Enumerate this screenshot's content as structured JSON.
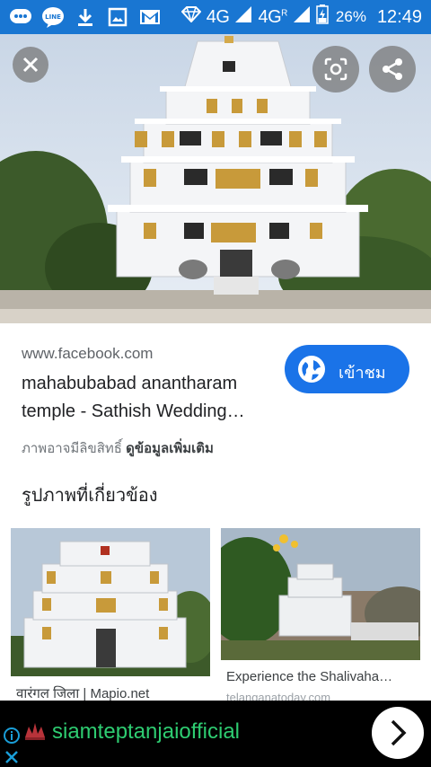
{
  "status_bar": {
    "network": "4G",
    "network2": "4G",
    "network2_sup": "R",
    "battery": "26%",
    "time": "12:49",
    "notification_icons": [
      "chat-bubble-icon",
      "line-app-icon",
      "download-icon",
      "image-icon",
      "gmail-icon"
    ]
  },
  "hero": {
    "buttons": [
      "close-icon",
      "lens-icon",
      "share-icon"
    ]
  },
  "result": {
    "domain": "www.facebook.com",
    "title": "mahabubabad anantharam temple - Sathish Wedding…",
    "visit_label": "เข้าชม",
    "copyright_text": "ภาพอาจมีลิขสิทธิ์",
    "more_info": "ดูข้อมูลเพิ่มเติม"
  },
  "related": {
    "heading": "รูปภาพที่เกี่ยวข้อง",
    "items": [
      {
        "caption": "वारंगल जिला | Mapio.net",
        "source": ""
      },
      {
        "caption": "Experience the Shalivaha…",
        "source": "telanganatoday.com"
      }
    ]
  },
  "ad": {
    "text": "siamteptanjaiofficial"
  },
  "colors": {
    "status_bar": "#1976d2",
    "accent": "#1a73e8",
    "ad_text": "#2ecc71"
  }
}
